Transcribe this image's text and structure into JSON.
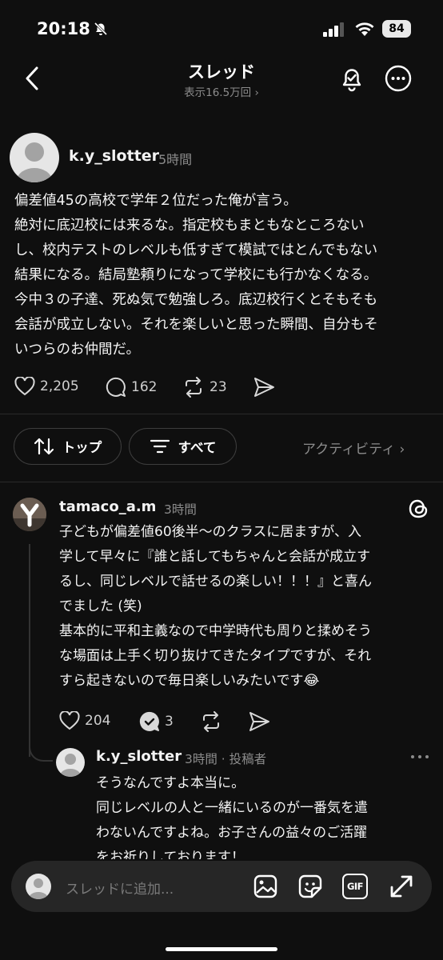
{
  "status_bar": {
    "time": "20:18",
    "battery": "84"
  },
  "nav": {
    "title": "スレッド",
    "subtitle": "表示16.5万回 ›"
  },
  "post": {
    "username": "k.y_slotter",
    "time": "5時間",
    "lines": [
      "偏差値45の高校で学年２位だった俺が言う。",
      "絶対に底辺校には来るな。指定校もまともなところない",
      "し、校内テストのレベルも低すぎて模試ではとんでもない",
      "結果になる。結局塾頼りになって学校にも行かなくなる。",
      "今中３の子達、死ぬ気で勉強しろ。底辺校行くとそもそも",
      "会話が成立しない。それを楽しいと思った瞬間、自分もそ",
      "いつらのお仲間だ。"
    ],
    "likes": "2,205",
    "replies": "162",
    "reposts": "23"
  },
  "filters": {
    "sort_label": "トップ",
    "filter_label": "すべて",
    "activity_label": "アクティビティ ›"
  },
  "comment": {
    "username": "tamaco_a.m",
    "time": "3時間",
    "lines": [
      "子どもが偏差値60後半〜のクラスに居ますが、入",
      "学して早々に『誰と話してもちゃんと会話が成立す",
      "るし、同じレベルで話せるの楽しい！！！』と喜ん",
      "でました (笑)",
      "基本的に平和主義なので中学時代も周りと揉めそう",
      "な場面は上手く切り抜けてきたタイプですが、それ",
      "すら起きないので毎日楽しいみたいです😂"
    ],
    "likes": "204",
    "replies": "3"
  },
  "reply": {
    "username": "k.y_slotter",
    "meta": "3時間 · 投稿者",
    "lines": [
      "そうなんですよ本当に。",
      "同じレベルの人と一緒にいるのが一番気を遣",
      "わないんですよね。お子さんの益々のご活躍",
      "をお祈りしております！"
    ]
  },
  "composer": {
    "placeholder": "スレッドに追加...",
    "gif_label": "GIF"
  },
  "icons": [
    "back-icon",
    "bell-icon",
    "more-icon",
    "heart-icon",
    "comment-icon",
    "repost-icon",
    "share-icon",
    "sort-icon",
    "filter-icon",
    "threads-logo-icon",
    "image-icon",
    "sticker-icon",
    "gif-icon",
    "expand-icon"
  ]
}
